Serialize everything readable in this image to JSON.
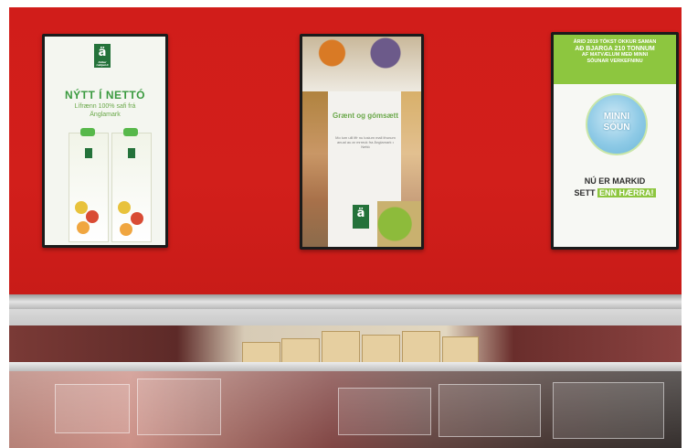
{
  "photo": {
    "left_panel": {
      "logo_glyph": "ä",
      "logo_sub": "Aldur rakjund",
      "headline": "NÝTT Í NETTÓ",
      "subtext": "Lífrænn 100% safi frá Änglamark"
    },
    "middle_panel": {
      "headline": "Grænt og gómsætt",
      "body": "Mo ium ulll lffr nu lusium mall ifrunum anual au ar mrreuk fra Änglamark • Nettó",
      "logo_glyph": "ä"
    },
    "right_panel": {
      "band_lines": [
        "ÁRID 2019 TÓKST OKKUR SAMAN",
        "AÐ BJARGA 210 TONNUM",
        "AF MATVÆLUM MEÐ MINNI",
        "SÓUNAR VERKEFNINU"
      ],
      "globe_lines": [
        "MINNI",
        "SÓUN"
      ],
      "line1": "NÚ ER MARKID",
      "line2_pre": "SETT",
      "line2_highlight": "ENN HÆRRA!"
    },
    "colors": {
      "wall": "#d11d1a",
      "brand_green": "#24723a",
      "accent_green": "#8dc63f"
    }
  }
}
